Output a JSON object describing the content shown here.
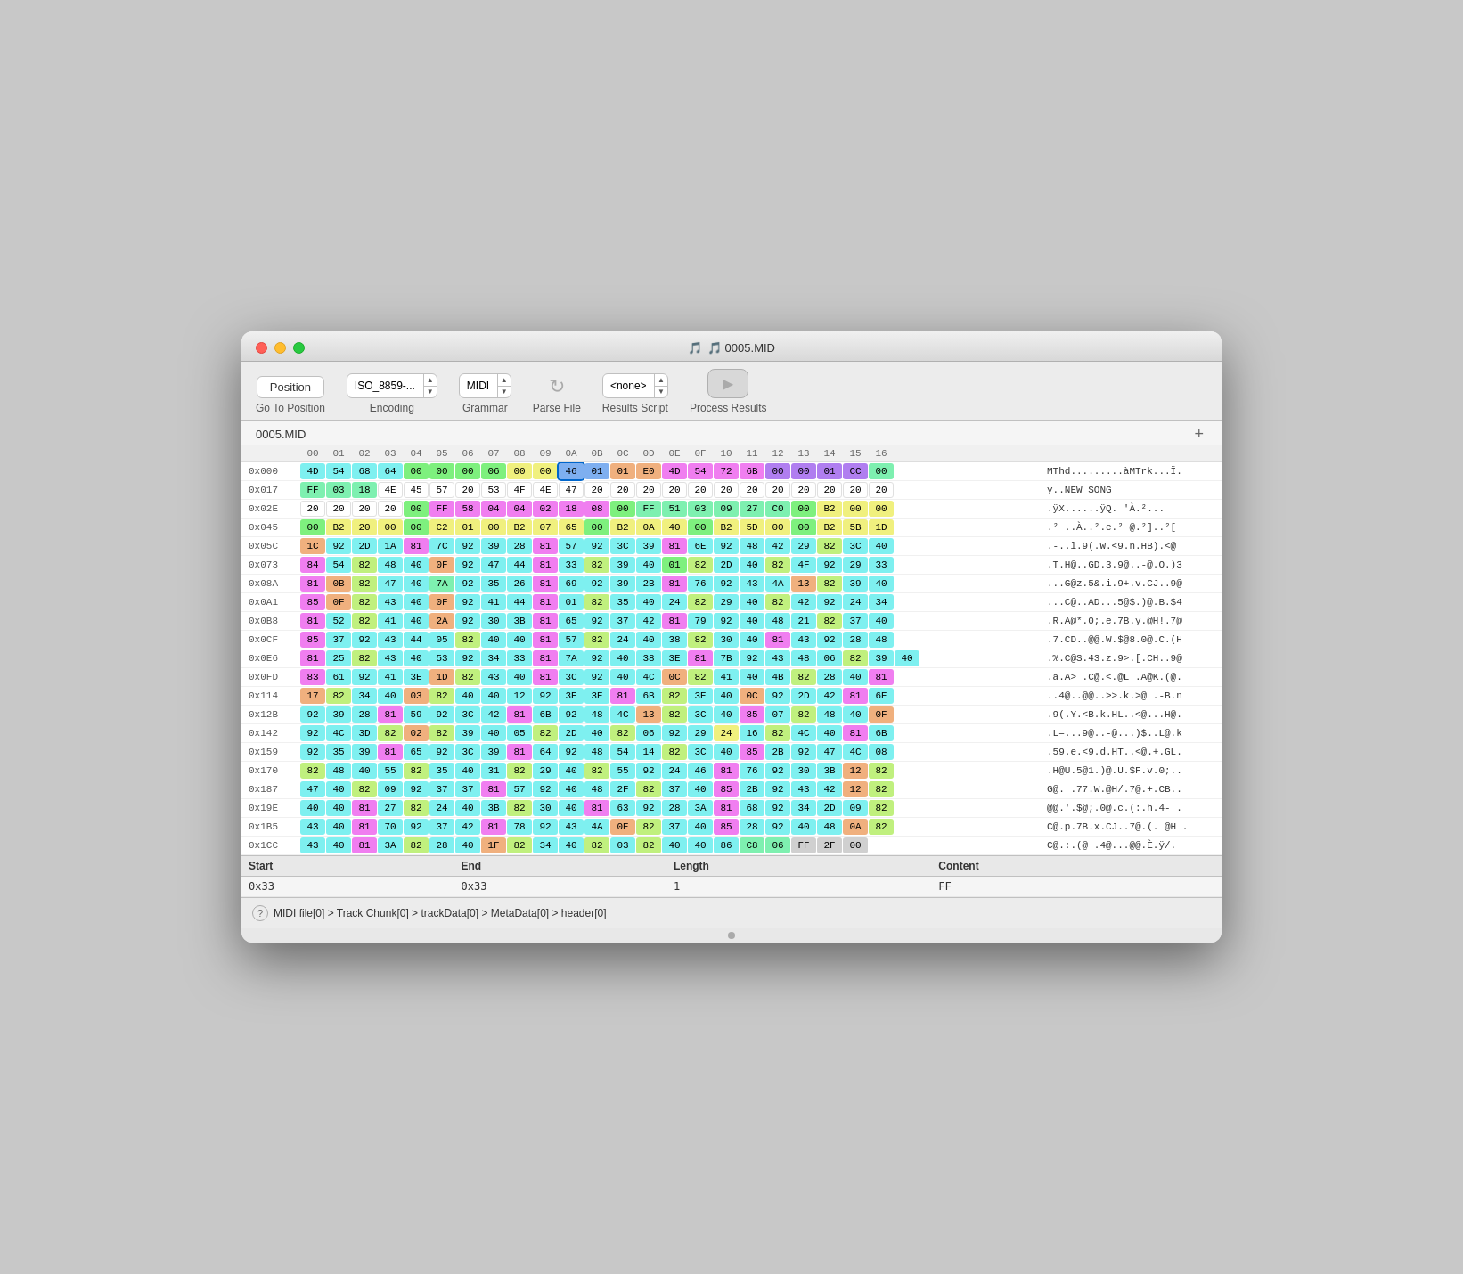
{
  "window": {
    "title": "🎵 0005.MID"
  },
  "toolbar": {
    "position_label": "Position",
    "encoding_label": "Encoding",
    "encoding_value": "ISO_8859-...",
    "grammar_label": "Grammar",
    "grammar_value": "MIDI",
    "parse_label": "Parse File",
    "results_script_label": "Results Script",
    "results_script_value": "<none>",
    "process_results_label": "Process Results",
    "go_to_position_label": "Go To Position"
  },
  "tab": {
    "title": "0005.MID",
    "add_label": "+"
  },
  "hex_header": [
    "00",
    "01",
    "02",
    "03",
    "04",
    "05",
    "06",
    "07",
    "08",
    "09",
    "0A",
    "0B",
    "0C",
    "0D",
    "0E",
    "0F",
    "10",
    "11",
    "12",
    "13",
    "14",
    "15",
    "16"
  ],
  "rows": [
    {
      "addr": "0x000",
      "ascii": "MThd.........àMTrk...Ï."
    },
    {
      "addr": "0x017",
      "ascii": "ÿ..NEW SONG"
    },
    {
      "addr": "0x02E",
      "ascii": ".ÿX......ÿQ. 'À.².."
    },
    {
      "addr": "0x045",
      "ascii": ".² ..À..².e.² @.²]..²["
    },
    {
      "addr": "0x05C",
      "ascii": ".-..l.9(.W.<9.n.HB).<@"
    },
    {
      "addr": "0x073",
      "ascii": ".T.H@..GD.3.9@..-@.O.)3"
    },
    {
      "addr": "0x08A",
      "ascii": "...G@z.5&.i.9+.v.CJ..9@"
    },
    {
      "addr": "0x0A1",
      "ascii": "...C@..AD...5@$.)@.B.$4"
    },
    {
      "addr": "0x0B8",
      "ascii": ".R.A@*.0;.e.7B.y.@H!.7@"
    },
    {
      "addr": "0x0CF",
      "ascii": ".7.CD..@@.W.$@8.0@.C.(H"
    },
    {
      "addr": "0x0E6",
      "ascii": ".%.C@S.43.z.9>.[.CH..9@"
    },
    {
      "addr": "0x0FD",
      "ascii": ".a.A> .C@.<.@L .A@K.(@."
    },
    {
      "addr": "0x114",
      "ascii": "..4@..@@..>>.k.>@ .-B.n"
    },
    {
      "addr": "0x12B",
      "ascii": ".9(.Y.<B.k.HL..<@...H@."
    },
    {
      "addr": "0x142",
      "ascii": ".L=...9@..-@...)$..L@.k"
    },
    {
      "addr": "0x159",
      "ascii": ".59.e.<9.d.HT..<@.+.GL."
    },
    {
      "addr": "0x170",
      "ascii": ".H@U.5@1.)@.U.$F.v.0;.."
    },
    {
      "addr": "0x187",
      "ascii": "G@. .77.W.@H/.7@.+.CB.."
    },
    {
      "addr": "0x19E",
      "ascii": "@@.'.$@;.0@.c.(:.h.4- ."
    },
    {
      "addr": "0x1B5",
      "ascii": "C@.p.7B.x.CJ..7@.(. @H ."
    },
    {
      "addr": "0x1CC",
      "ascii": "C@.:.(@ .4@...@@.È.ÿ/."
    }
  ],
  "results": {
    "headers": [
      "Start",
      "End",
      "Length",
      "Content"
    ],
    "rows": [
      {
        "start": "0x33",
        "end": "0x33",
        "length": "1",
        "content": "FF"
      }
    ]
  },
  "breadcrumb": "MIDI file[0] > Track Chunk[0] > trackData[0] > MetaData[0] > header[0]"
}
